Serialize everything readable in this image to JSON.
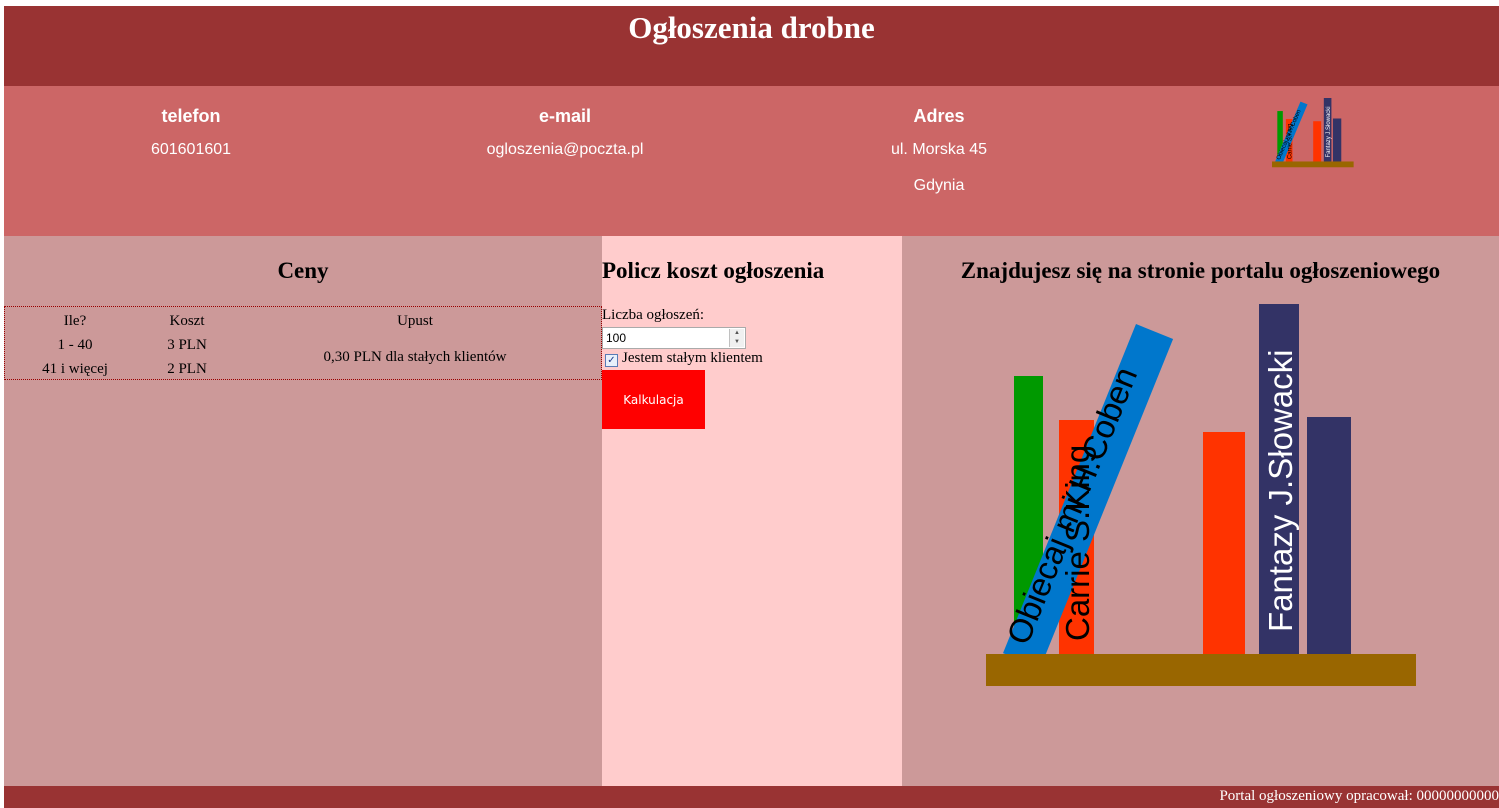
{
  "header": {
    "title": "Ogłoszenia drobne"
  },
  "contact": {
    "phone_heading": "telefon",
    "phone": "601601601",
    "email_heading": "e-mail",
    "email": "ogloszenia@poczta.pl",
    "address_heading": "Adres",
    "street": "ul. Morska 45",
    "city": "Gdynia"
  },
  "books": {
    "carrie": "Carrie  S.King",
    "coben": "Obiecaj mi  H.Coben",
    "fantazy": "Fantazy  J.Słowacki"
  },
  "prices": {
    "heading": "Ceny",
    "col_qty": "Ile?",
    "col_cost": "Koszt",
    "col_discount": "Upust",
    "row1_qty": "1 - 40",
    "row1_cost": "3 PLN",
    "row2_qty": "41 i więcej",
    "row2_cost": "2 PLN",
    "discount": "0,30 PLN dla stałych klientów"
  },
  "calculator": {
    "heading": "Policz koszt ogłoszenia",
    "count_label": "Liczba ogłoszeń:",
    "count_value": "100",
    "regular_label": "Jestem stałym klientem",
    "regular_checked": true,
    "button_label": "Kalkulacja"
  },
  "right": {
    "heading": "Znajdujesz się na stronie portalu ogłoszeniowego"
  },
  "footer": {
    "text": "Portal ogłoszeniowy opracował: 00000000000"
  },
  "colors": {
    "header_bg": "#993333",
    "contact_bg": "#cc6666",
    "panel_bg": "#cc9999",
    "calc_bg": "#ffcccc",
    "button_bg": "#ff0000",
    "book_green": "#009900",
    "book_orange": "#ff3300",
    "book_blue": "#0077cc",
    "book_navy": "#333366",
    "shelf": "#996600"
  }
}
